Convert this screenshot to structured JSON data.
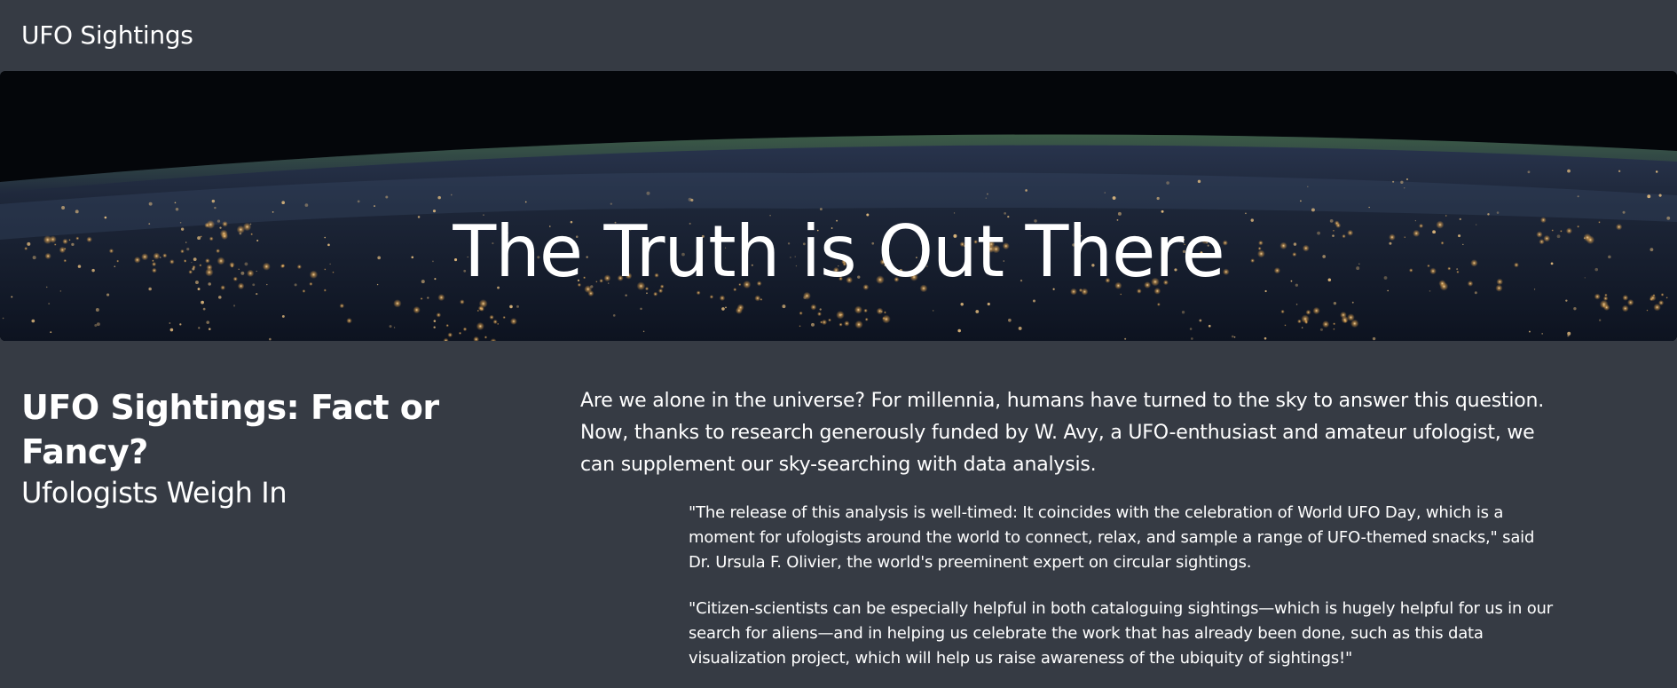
{
  "navbar": {
    "brand": "UFO Sightings"
  },
  "hero": {
    "title": "The Truth is Out There"
  },
  "article": {
    "headline": "UFO Sightings: Fact or Fancy?",
    "subheadline": "Ufologists Weigh In",
    "intro": "Are we alone in the universe? For millennia, humans have turned to the sky to answer this question. Now, thanks to research generously funded by W. Avy, a UFO-enthusiast and amateur ufologist, we can supplement our sky-searching with data analysis.",
    "quotes": [
      "\"The release of this analysis is well-timed: It coincides with the celebration of World UFO Day, which is a moment for ufologists around the world to connect, relax, and sample a range of UFO-themed snacks,\" said Dr. Ursula F. Olivier, the world's preeminent expert on circular sightings.",
      "\"Citizen-scientists can be especially helpful in both cataloguing sightings—which is hugely helpful for us in our search for aliens—and in helping us celebrate the work that has already been done, such as this data visualization project, which will help us raise awareness of the ubiquity of sightings!\""
    ]
  },
  "colors": {
    "background": "#363b44",
    "text": "#ffffff",
    "space": "#04060a",
    "earth": "#1c2434",
    "city_lights": "#f2c27a",
    "atmosphere": "#3d6a3a"
  }
}
